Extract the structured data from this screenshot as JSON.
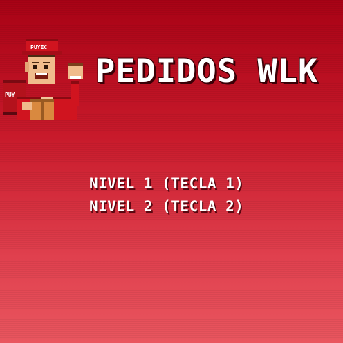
{
  "title": "PEDIDOS WLK",
  "mascot": {
    "cap_text": "PUYEC",
    "box_text": "PUY"
  },
  "menu": {
    "options": [
      {
        "label": "NIVEL 1 (TECLA 1)"
      },
      {
        "label": "NIVEL 2 (TECLA 2)"
      }
    ]
  }
}
